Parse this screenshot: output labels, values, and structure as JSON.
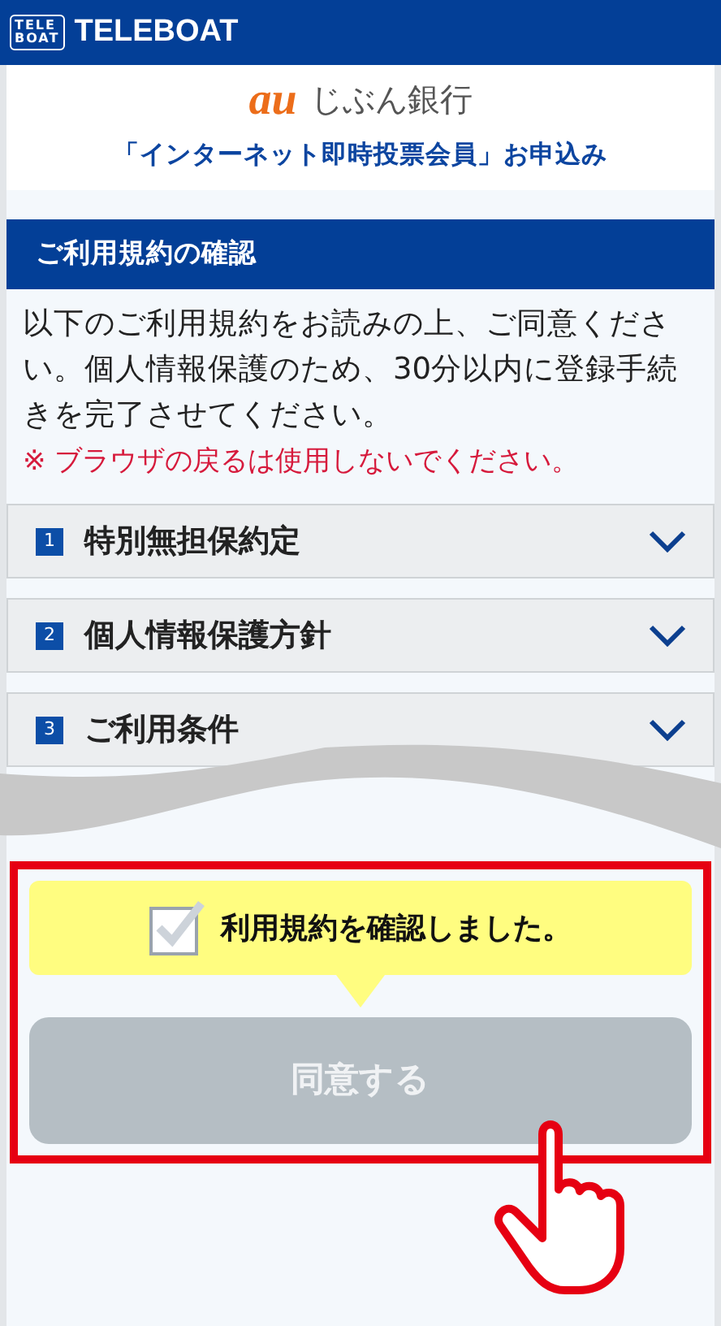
{
  "header": {
    "logo_mark": [
      "TELE",
      "BOAT"
    ],
    "brand": "TELEBOAT"
  },
  "bank": {
    "logo": "au",
    "name": "じぶん銀行"
  },
  "title": "「インターネット即時投票会員」お申込み",
  "section": {
    "heading": "ご利用規約の確認",
    "body": "以下のご利用規約をお読みの上、ご同意ください。個人情報保護のため、30分以内に登録手続きを完了させてください。",
    "warning": "※ ブラウザの戻るは使用しないでください。"
  },
  "terms": [
    {
      "number": "1",
      "label": "特別無担保約定",
      "expanded": false
    },
    {
      "number": "2",
      "label": "個人情報保護方針",
      "expanded": false
    },
    {
      "number": "3",
      "label": "ご利用条件",
      "expanded": false
    }
  ],
  "confirm": {
    "label": "利用規約を確認しました。",
    "checked": true
  },
  "agree_button": {
    "label": "同意する",
    "disabled": true
  }
}
